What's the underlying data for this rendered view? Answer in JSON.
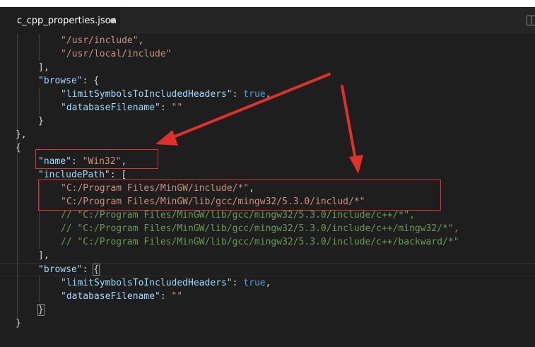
{
  "tab": {
    "filename": "c_cpp_properties.json"
  },
  "icons": {
    "dirty": "unsaved-dot-icon",
    "split": "split-editor-icon"
  },
  "colors": {
    "key": "#9cdcfe",
    "string": "#ce9178",
    "boolean": "#569cd6",
    "comment": "#6a9955",
    "annotation": "#e0302a"
  },
  "code": {
    "l1_str": "\"/usr/include\"",
    "l2_str": "\"/usr/local/include\"",
    "l3": "],",
    "l4_key": "\"browse\"",
    "l4_rest": ": {",
    "l5_key": "\"limitSymbolsToIncludedHeaders\"",
    "l5_colon": ": ",
    "l5_val": "true",
    "l5_end": ",",
    "l6_key": "\"databaseFilename\"",
    "l6_colon": ": ",
    "l6_val": "\"\"",
    "l7": "}",
    "l8": "},",
    "l9": "{",
    "l10_key": "\"name\"",
    "l10_colon": ": ",
    "l10_val": "\"Win32\"",
    "l10_end": ",",
    "l11_key": "\"includePath\"",
    "l11_rest": ": [",
    "l12_str": "\"C:/Program Files/MinGW/include/*\"",
    "l12_end": ",",
    "l13_str": "\"C:/Program Files/MinGW/lib/gcc/mingw32/5.3.0/includ/*\"",
    "l14": "// \"C:/Program Files/MinGW/lib/gcc/mingw32/5.3.0/include/c++/*\",",
    "l15": "// \"C:/Program Files/MinGW/lib/gcc/mingw32/5.3.0/include/c++/mingw32/*\",",
    "l16": "// \"C:/Program Files/MinGW/lib/gcc/mingw32/5.3.0/include/c++/backward/*\"",
    "l17": "],",
    "l18_key": "\"browse\"",
    "l18_colon": ": ",
    "l18_brace": "{",
    "l19_key": "\"limitSymbolsToIncludedHeaders\"",
    "l19_colon": ": ",
    "l19_val": "true",
    "l19_end": ",",
    "l20_key": "\"databaseFilename\"",
    "l20_colon": ": ",
    "l20_val": "\"\"",
    "l21": "}",
    "l22": "}"
  }
}
